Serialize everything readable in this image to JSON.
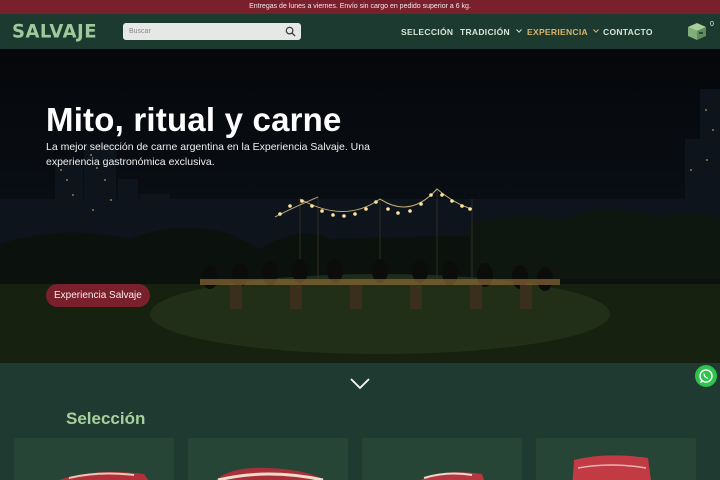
{
  "announcement": "Entregas de lunes a viernes. Envío sin cargo en pedido superior a 6 kg.",
  "header": {
    "logo": "SALVAJE",
    "search_placeholder": "Buscar",
    "nav": [
      {
        "label": "SELECCIÓN",
        "has_dropdown": false,
        "active": false
      },
      {
        "label": "TRADICIÓN",
        "has_dropdown": true,
        "active": false
      },
      {
        "label": "EXPERIENCIA",
        "has_dropdown": true,
        "active": true
      },
      {
        "label": "CONTACTO",
        "has_dropdown": false,
        "active": false
      }
    ],
    "cart_count": "0"
  },
  "hero": {
    "title": "Mito, ritual y carne",
    "subtitle": "La mejor selección de carne argentina en la Experiencia Salvaje. Una experiencia gastronómica exclusiva.",
    "cta": "Experiencia Salvaje"
  },
  "selection": {
    "title": "Selección",
    "cards": [
      {
        "icon": "meat-cut-image"
      },
      {
        "icon": "meat-cut-image"
      },
      {
        "icon": "meat-cut-image"
      },
      {
        "icon": "meat-cut-image"
      }
    ]
  },
  "colors": {
    "brand_green": "#1d3a30",
    "accent_burgundy": "#7a1f2c",
    "logo_green": "#9ec99a",
    "active_gold": "#d8b56a",
    "whatsapp_green": "#2fc24d"
  }
}
